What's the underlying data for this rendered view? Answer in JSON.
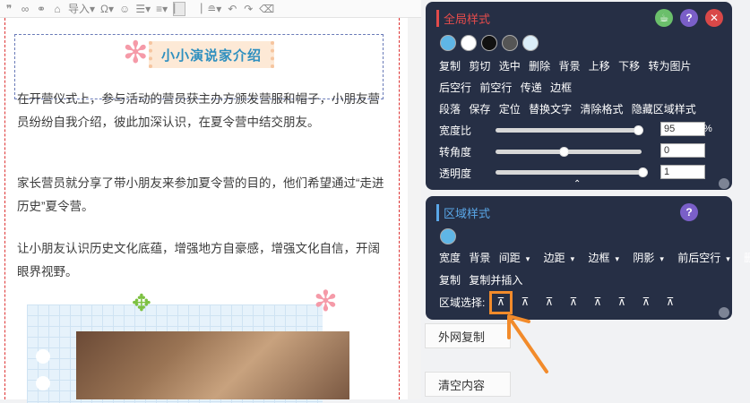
{
  "toolbar": {
    "items": [
      "quote-icon",
      "link-icon",
      "unlink-icon",
      "format-brush-icon",
      "import-icon",
      "omega-icon",
      "emoji-icon",
      "ordered-list-icon",
      "unordered-list-icon",
      "align-left-icon",
      "align-right-icon",
      "text-style-icon",
      "undo-icon",
      "redo-icon",
      "clear-icon"
    ],
    "import_label": "导入"
  },
  "article": {
    "title": "小小演说家介绍",
    "para1": "在开营仪式上，参与活动的营员获主办方颁发营服和帽子，小朋友营员纷纷自我介绍，彼此加深认识，在夏令营中结交朋友。",
    "para2": "家长营员就分享了带小朋友来参加夏令营的目的，他们希望通过“走进历史”夏令营。",
    "para3": "让小朋友认识历史文化底蕴，增强地方自豪感，增强文化自信，开阔眼界视野。"
  },
  "global_panel": {
    "title": "全局样式",
    "swatches": [
      "#5fb6e6",
      "#ffffff",
      "#111111",
      "#555555",
      "#dbeef9"
    ],
    "actions_row1": [
      "复制",
      "剪切",
      "选中",
      "删除",
      "背景",
      "上移",
      "下移",
      "转为图片"
    ],
    "actions_row2": [
      "后空行",
      "前空行",
      "传递",
      "边框"
    ],
    "actions_row3": [
      "段落",
      "保存",
      "定位",
      "替换文字",
      "清除格式",
      "隐藏区域样式"
    ],
    "sliders": [
      {
        "label": "宽度比",
        "value": "95",
        "unit": "%",
        "level": 0.97
      },
      {
        "label": "转角度",
        "value": "0",
        "unit": "",
        "level": 0.5
      },
      {
        "label": "透明度",
        "value": "1",
        "unit": "",
        "level": 0.99
      }
    ],
    "icon_colors": {
      "cup": "#6bbf6b",
      "help": "#7a5fc8",
      "close": "#d94848"
    }
  },
  "region_panel": {
    "title": "区域样式",
    "swatches": [
      "#5fb6e6"
    ],
    "actions_row1": [
      "宽度",
      "背景",
      "间距",
      "边距",
      "边框",
      "阴影",
      "前后空行",
      "删除"
    ],
    "dropdown_items": [
      "间距",
      "边距",
      "边框",
      "阴影",
      "前后空行"
    ],
    "actions_row2": [
      "复制",
      "复制并插入"
    ],
    "selector_label": "区域选择:",
    "selector_glyph": "⊼"
  },
  "side_buttons": {
    "external_copy": "外网复制",
    "clear_content": "清空内容"
  },
  "colors": {
    "panel_bg": "#262f45",
    "global_title": "#e74c4c",
    "region_title": "#5aa7e8",
    "highlight": "#f28b2b"
  }
}
